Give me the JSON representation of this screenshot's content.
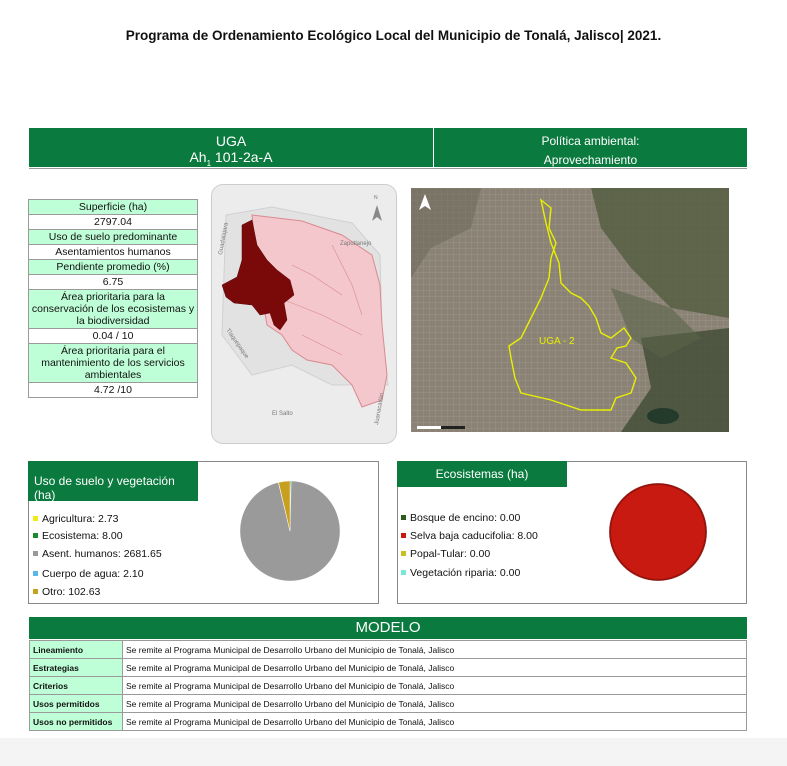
{
  "doc_title": "Programa de Ordenamiento Ecológico Local del Municipio de Tonalá, Jalisco| 2021.",
  "header": {
    "uga_label": "UGA",
    "uga_code_prefix": "Ah",
    "uga_code_sub": "1",
    "uga_code_suffix": " 101-2a-A",
    "policy_label": "Política ambiental:",
    "policy_value": "Aprovechamiento"
  },
  "attributes": [
    {
      "label": "Superficie (ha)",
      "value": "2797.04"
    },
    {
      "label": "Uso de suelo predominante",
      "value": "Asentamientos humanos"
    },
    {
      "label": "Pendiente promedio (%)",
      "value": "6.75"
    },
    {
      "label": "Área prioritaria para la conservación de los ecosistemas y la biodiversidad",
      "value": "0.04 / 10"
    },
    {
      "label": "Área prioritaria para el mantenimiento de los servicios ambientales",
      "value": "4.72 /10"
    }
  ],
  "map_locator": {
    "north": "N",
    "labels": [
      "Guadalajara",
      "Zapotlanejo",
      "Tlaquepaque",
      "El Salto",
      "Juanacatlán"
    ],
    "colors": {
      "uga": "#7a0a0a",
      "municipio": "#f3c7cb"
    }
  },
  "map_satellite": {
    "label": "UGA - 2",
    "outline_color": "#e8f000"
  },
  "uso_suelo": {
    "title": "Uso de suelo y vegetación (ha)",
    "items": [
      {
        "label": "Agricultura: 2.73",
        "color": "#f4e81a"
      },
      {
        "label": "Ecosistema: 8.00",
        "color": "#1a8a2a"
      },
      {
        "label": "Asent. humanos: 2681.65",
        "color": "#9a9a9a"
      },
      {
        "label": "Cuerpo de agua: 2.10",
        "color": "#5ab8e8"
      },
      {
        "label": "Otro: 102.63",
        "color": "#c8a020"
      }
    ]
  },
  "ecosistemas": {
    "title": "Ecosistemas (ha)",
    "items": [
      {
        "label": "Bosque de encino: 0.00",
        "color": "#2e5a1e"
      },
      {
        "label": "Selva baja caducifolia: 8.00",
        "color": "#c81a10"
      },
      {
        "label": "Popal-Tular: 0.00",
        "color": "#c8c020"
      },
      {
        "label": "Vegetación riparia: 0.00",
        "color": "#7ae8d8"
      }
    ]
  },
  "chart_data": [
    {
      "type": "pie",
      "categories": [
        "Agricultura",
        "Ecosistema",
        "Asent. humanos",
        "Cuerpo de agua",
        "Otro"
      ],
      "values": [
        2.73,
        8.0,
        2681.65,
        2.1,
        102.63
      ],
      "colors": [
        "#f4e81a",
        "#1a8a2a",
        "#9a9a9a",
        "#5ab8e8",
        "#c8a020"
      ]
    },
    {
      "type": "pie",
      "categories": [
        "Bosque de encino",
        "Selva baja caducifolia",
        "Popal-Tular",
        "Vegetación riparia"
      ],
      "values": [
        0.0,
        8.0,
        0.0,
        0.0
      ],
      "colors": [
        "#2e5a1e",
        "#c81a10",
        "#c8c020",
        "#7ae8d8"
      ]
    }
  ],
  "modelo": {
    "title": "MODELO",
    "rows": [
      {
        "key": "Lineamiento",
        "value": "Se remite al Programa Municipal de Desarrollo Urbano del Municipio de Tonalá, Jalisco"
      },
      {
        "key": "Estrategias",
        "value": "Se remite al Programa Municipal de Desarrollo Urbano del Municipio de Tonalá, Jalisco"
      },
      {
        "key": "Criterios",
        "value": "Se remite al Programa Municipal de Desarrollo Urbano del Municipio de Tonalá, Jalisco"
      },
      {
        "key": "Usos permitidos",
        "value": "Se remite al Programa Municipal de Desarrollo Urbano del Municipio de Tonalá, Jalisco"
      },
      {
        "key": "Usos no permitidos",
        "value": "Se remite al Programa Municipal de Desarrollo Urbano del Municipio de Tonalá, Jalisco"
      }
    ]
  }
}
